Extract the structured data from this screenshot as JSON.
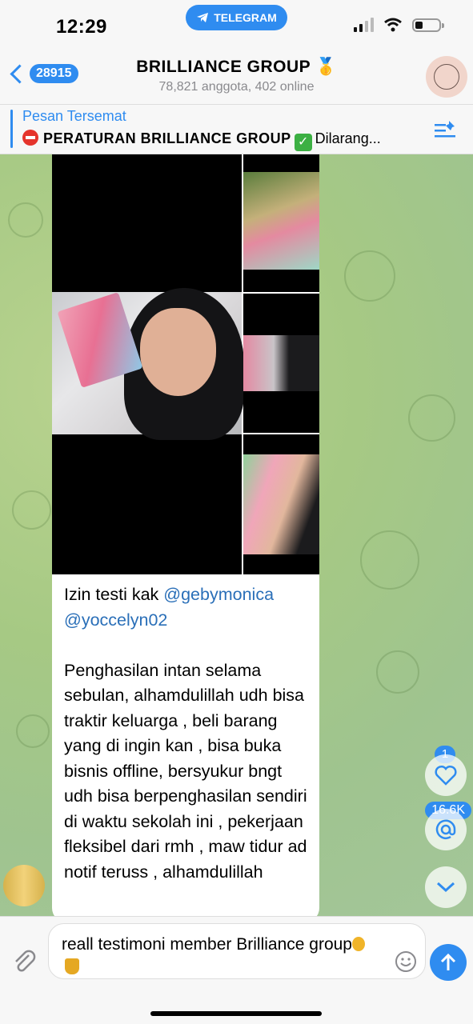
{
  "status": {
    "time": "12:29",
    "app_pill": "TELEGRAM"
  },
  "header": {
    "back_count": "28915",
    "title": "BRILLIANCE GROUP 🥇",
    "subtitle": "78,821 anggota, 402 online"
  },
  "pinned": {
    "label": "Pesan Tersemat",
    "text_bold": "PERATURAN BRILLIANCE GROUP",
    "text_rest": "Dilarang..."
  },
  "message": {
    "line_intro": "Izin testi kak ",
    "mention1": "@gebymonica",
    "mention2": "@yoccelyn02",
    "body": "Penghasilan intan selama sebulan, alhamdulillah udh bisa traktir keluarga , beli barang yang di ingin kan , bisa buka bisnis offline, bersyukur bngt udh bisa berpenghasilan sendiri di waktu sekolah ini , pekerjaan fleksibel dari rmh , maw tidur ad notif teruss , alhamdulillah"
  },
  "side": {
    "reaction_count": "1",
    "mention_count": "16.6K"
  },
  "composer": {
    "text": "reall testimoni member Brilliance group"
  },
  "colors": {
    "accent": "#2f8cf0",
    "mention": "#2a6fb8"
  },
  "icons": [
    "telegram-icon",
    "signal-icon",
    "wifi-icon",
    "battery-icon",
    "back-chevron-icon",
    "stop-icon",
    "check-icon",
    "pinned-list-icon",
    "heart-icon",
    "at-icon",
    "chevron-down-icon",
    "attach-icon",
    "emoji-icon",
    "send-arrow-icon"
  ]
}
